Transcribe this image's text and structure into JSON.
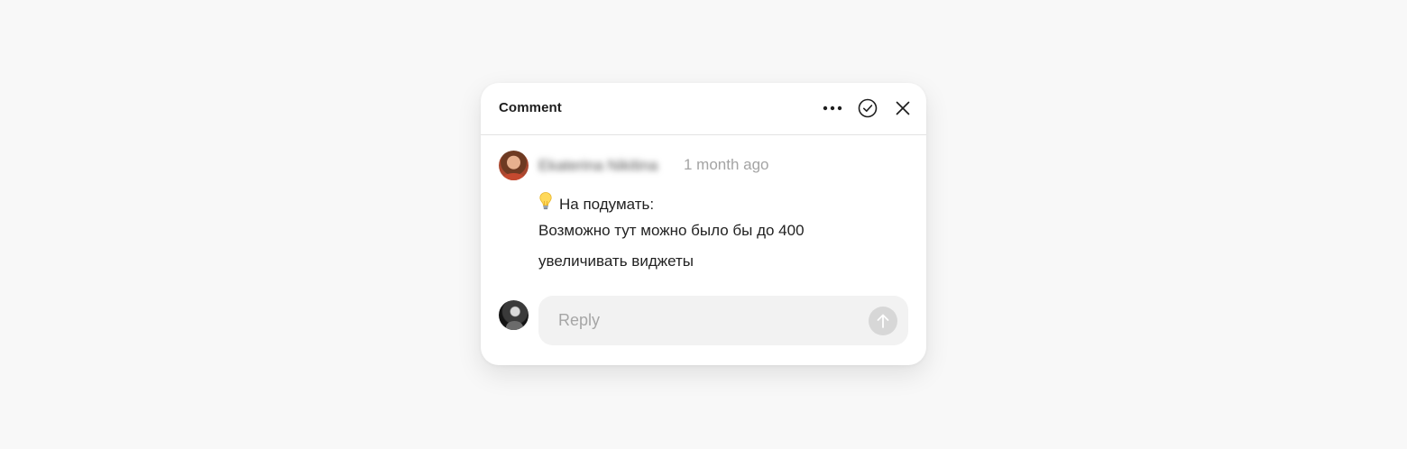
{
  "comment_panel": {
    "title": "Comment",
    "actions": {
      "more_icon": "more-horizontal-icon",
      "resolve_icon": "check-circle-icon",
      "close_icon": "close-icon"
    }
  },
  "comment": {
    "author": "Ekaterina Nikitina",
    "timestamp": "1 month ago",
    "emoji_icon": "lightbulb-icon",
    "lines": [
      "На подумать:",
      "Возможно тут можно было бы до 400",
      "увеличивать виджеты"
    ]
  },
  "reply": {
    "placeholder": "Reply",
    "value": "",
    "send_icon": "arrow-up-icon"
  },
  "colors": {
    "background": "#f8f8f8",
    "card": "#ffffff",
    "reply_field": "#f2f2f2",
    "send_button": "#d7d7d7",
    "timestamp": "#a4a4a4"
  }
}
